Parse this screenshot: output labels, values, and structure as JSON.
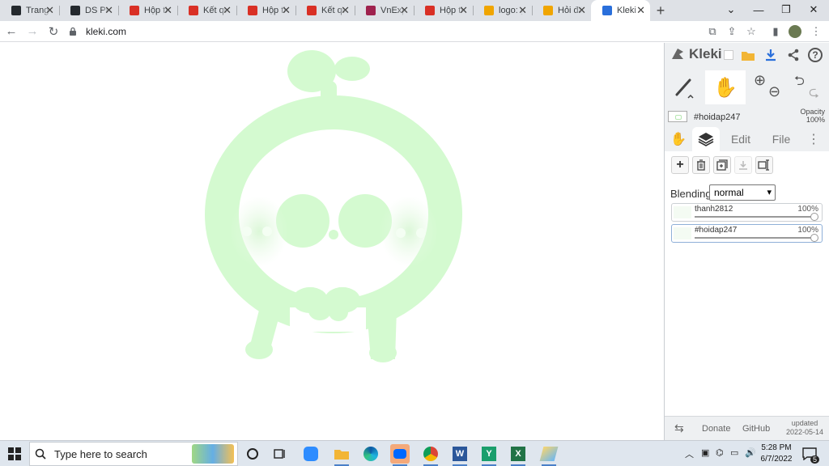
{
  "browser": {
    "tabs": [
      {
        "title": "Trang",
        "icon": "github-icon",
        "color": "#24292e"
      },
      {
        "title": "DS PH",
        "icon": "github-icon",
        "color": "#24292e"
      },
      {
        "title": "Hộp th",
        "icon": "gmail-icon",
        "color": "#d93025"
      },
      {
        "title": "Kết qu",
        "icon": "gmail-icon",
        "color": "#d93025"
      },
      {
        "title": "Hộp th",
        "icon": "gmail-icon",
        "color": "#d93025"
      },
      {
        "title": "Kết qu",
        "icon": "gmail-icon",
        "color": "#d93025"
      },
      {
        "title": "VnExp",
        "icon": "vnexpress-icon",
        "color": "#9f224e"
      },
      {
        "title": "Hộp th",
        "icon": "gmail-icon",
        "color": "#d93025"
      },
      {
        "title": "logo: g",
        "icon": "hoidap-icon",
        "color": "#f0a500"
      },
      {
        "title": "Hỏi đá",
        "icon": "hoidap-icon",
        "color": "#f0a500"
      },
      {
        "title": "Kleki -",
        "icon": "kleki-icon",
        "color": "#2a6fdb",
        "active": true
      }
    ],
    "url": "kleki.com"
  },
  "kleki": {
    "logo": "Kleki",
    "color_name": "#hoidap247",
    "opacity_label": "Opacity",
    "opacity_value": "100%",
    "tabs": {
      "edit": "Edit",
      "file": "File"
    },
    "blending_label": "Blending",
    "blending_value": "normal",
    "layers": [
      {
        "name": "thanh2812",
        "opacity": "100%",
        "active": false
      },
      {
        "name": "#hoidap247",
        "opacity": "100%",
        "active": true
      }
    ],
    "footer": {
      "donate": "Donate",
      "github": "GitHub",
      "updated_label": "updated",
      "updated_date": "2022-05-14"
    }
  },
  "colors": {
    "drawing_green": "#d4fad0",
    "accent": "#2a6fdb"
  },
  "taskbar": {
    "search_placeholder": "Type here to search",
    "time": "5:28 PM",
    "date": "6/7/2022",
    "notifications": "5"
  }
}
